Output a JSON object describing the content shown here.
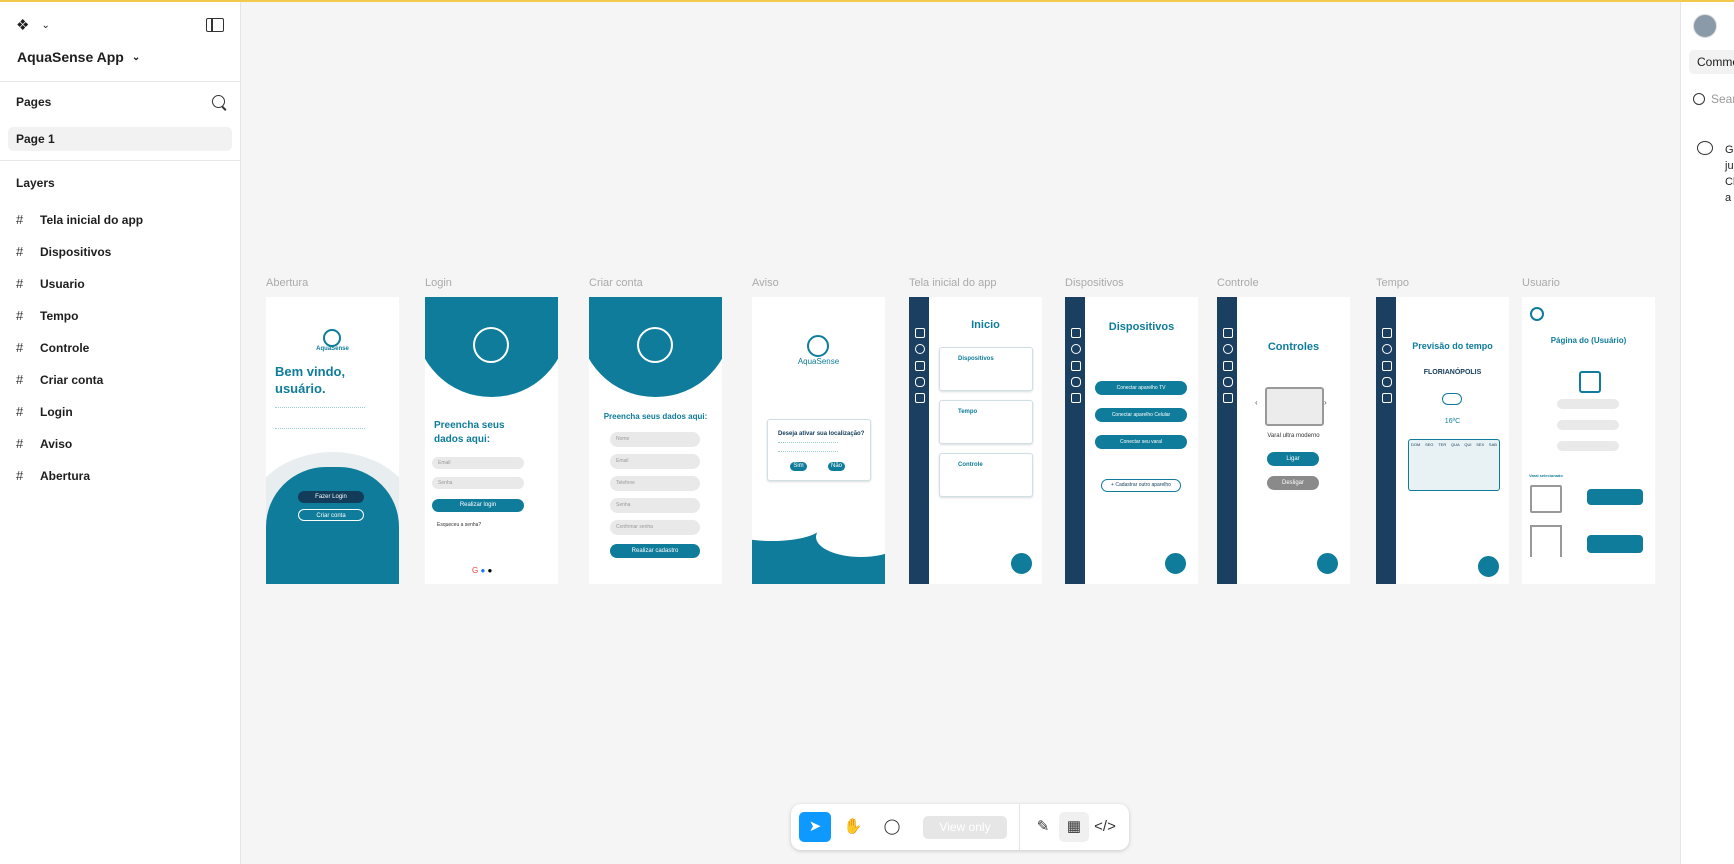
{
  "file": {
    "title": "AquaSense App"
  },
  "pages_panel": {
    "title": "Pages",
    "items": [
      "Page 1"
    ]
  },
  "layers_panel": {
    "title": "Layers",
    "items": [
      "Tela inicial do app",
      "Dispositivos",
      "Usuario",
      "Tempo",
      "Controle",
      "Criar conta",
      "Login",
      "Aviso",
      "Abertura"
    ]
  },
  "right_panel": {
    "tab": "Comme",
    "search_placeholder": "Sear",
    "comment_lines": [
      "Gi",
      "ju",
      "Cl",
      "a"
    ]
  },
  "frames": {
    "labels": [
      "Abertura",
      "Login",
      "Criar conta",
      "Aviso",
      "Tela inicial do app",
      "Dispositivos",
      "Controle",
      "Tempo",
      "Usuario"
    ],
    "abertura": {
      "brand": "AquaSense",
      "welcome": "Bem vindo, usuário.",
      "login_btn": "Fazer Login",
      "create_btn": "Criar conta"
    },
    "login": {
      "heading": "Preencha seus dados aqui:",
      "email": "Email",
      "senha": "Senha",
      "submit": "Realizar login",
      "forgot": "Esqueceu a senha?"
    },
    "criar": {
      "heading": "Preencha seus dados aqui:",
      "fields": [
        "Nome",
        "Email",
        "Telefone",
        "Senha",
        "Confirmar senha"
      ],
      "submit": "Realizar cadastro"
    },
    "aviso": {
      "brand": "AquaSense",
      "question": "Deseja ativar sua localização?",
      "yes": "Sim",
      "no": "Não"
    },
    "inicio": {
      "title": "Inicio",
      "cards": [
        "Dispositivos",
        "Tempo",
        "Controle"
      ]
    },
    "dispositivos": {
      "title": "Dispositivos",
      "buttons": [
        "Conectar aparelho TV",
        "Conectar aparelho Celular",
        "Conectar seu varal"
      ],
      "add": "+ Cadastrar outro aparelho"
    },
    "controle": {
      "title": "Controles",
      "device": "Varal ultra moderno",
      "on": "Ligar",
      "off": "Desligar"
    },
    "tempo": {
      "title": "Previsão do tempo",
      "city": "FLORIANÓPOLIS",
      "temp": "16ºC",
      "days": [
        "DOM",
        "SEG",
        "TER",
        "QUA",
        "QUI",
        "SEX",
        "SAB"
      ]
    },
    "usuario": {
      "title": "Página do (Usuário)",
      "selected": "Varal selecionado"
    }
  },
  "toolbar": {
    "view_only": "View only"
  }
}
